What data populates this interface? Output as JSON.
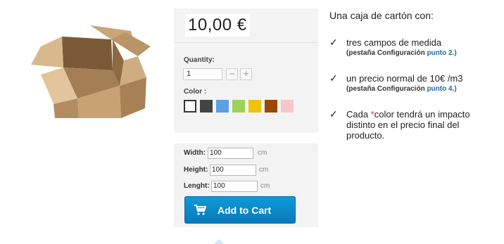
{
  "product": {
    "price": "10,00 €",
    "image_alt": "caja de cartón"
  },
  "options": {
    "quantity_label": "Quantity:",
    "quantity_value": "1",
    "minus_icon": "minus-icon",
    "plus_icon": "plus-icon",
    "color_label": "Color :",
    "colors": [
      "#ffffff",
      "#434343",
      "#5b9fe6",
      "#9ed15a",
      "#f0c20c",
      "#9b4707",
      "#f8c6cb"
    ]
  },
  "dimensions": {
    "width_label": "Width:",
    "width_value": "100",
    "height_label": "Height:",
    "height_value": "100",
    "length_label": "Lenght:",
    "length_value": "100",
    "unit": "cm"
  },
  "cart": {
    "label": "Add to Cart",
    "icon": "cart-icon"
  },
  "description": {
    "title": "Una caja de cartón con:",
    "items": [
      {
        "text": "tres campos de medida",
        "sub_prefix": "(pestaña Configuración ",
        "sub_highlight": "punto 2.)"
      },
      {
        "text": "un precio normal de 10€ /m3",
        "sub_prefix": "(pestaña Configuración ",
        "sub_highlight": "punto 4.)"
      },
      {
        "text_prefix": "Cada ",
        "asterisk": "*",
        "text_rest_line1": "color tendrá un impacto",
        "text_line2": "distinto en el precio final del",
        "text_line3": "producto."
      }
    ]
  }
}
